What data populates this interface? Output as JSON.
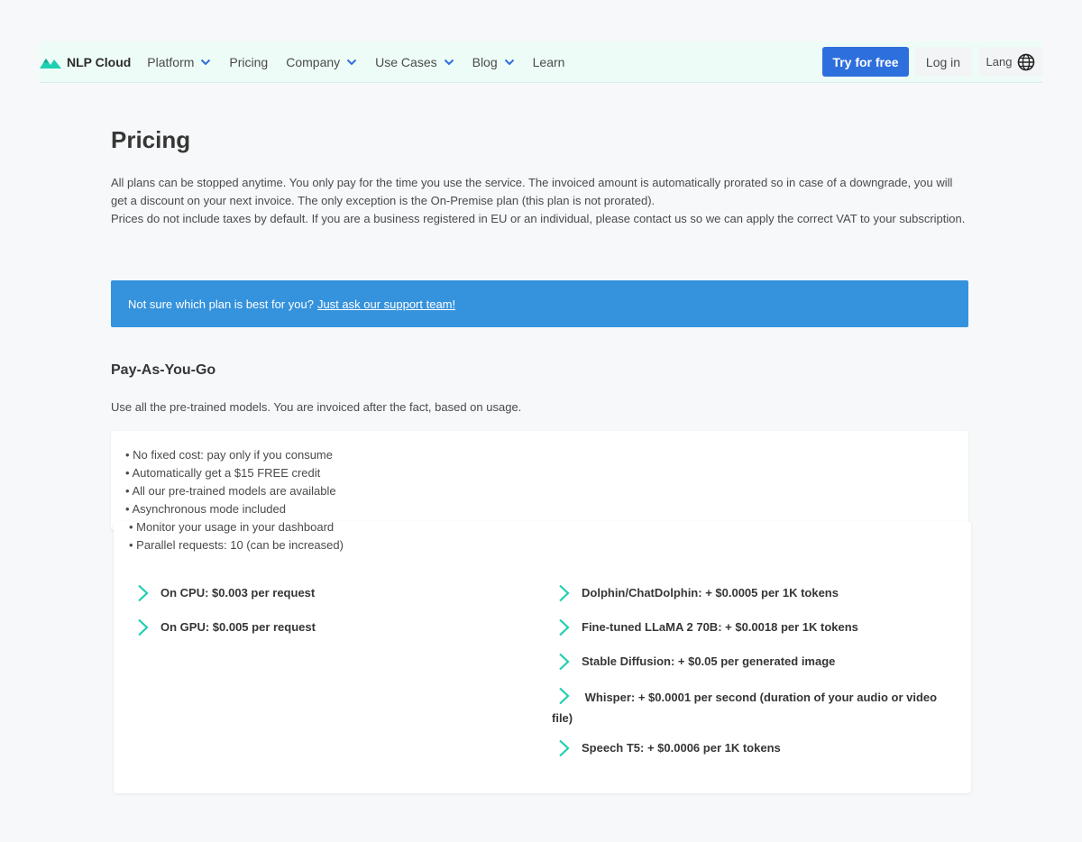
{
  "nav": {
    "brand": "NLP Cloud",
    "items": [
      {
        "label": "Platform",
        "dropdown": true
      },
      {
        "label": "Pricing",
        "dropdown": false
      },
      {
        "label": "Company",
        "dropdown": true
      },
      {
        "label": "Use Cases",
        "dropdown": true
      },
      {
        "label": "Blog",
        "dropdown": true
      },
      {
        "label": "Learn",
        "dropdown": false
      }
    ],
    "try_label": "Try for free",
    "login_label": "Log in",
    "lang_label": "Lang"
  },
  "colors": {
    "accent": "#2d6fdc",
    "teal": "#1fcfb1",
    "banner": "#3592dc"
  },
  "page": {
    "title": "Pricing",
    "intro_1": "All plans can be stopped anytime. You only pay for the time you use the service. The invoiced amount is automatically prorated so in case of a downgrade, you will get a discount on your next invoice. The only exception is the On-Premise plan (this plan is not prorated).",
    "intro_2": "Prices do not include taxes by default. If you are a business registered in EU or an individual, please contact us so we can apply the correct VAT to your subscription."
  },
  "banner": {
    "text": "Not sure which plan is best for you?",
    "link": "Just ask our support team!"
  },
  "plan": {
    "title": "Pay-As-You-Go",
    "description": "Use all the pre-trained models. You are invoiced after the fact, based on usage.",
    "features": [
      "• No fixed cost: pay only if you consume",
      "• Automatically get a $15 FREE credit",
      "• All our pre-trained models are available",
      "• Asynchronous mode included",
      "• Monitor your usage in your dashboard",
      "• Parallel requests: 10 (can be increased)"
    ],
    "prices_left": [
      "On CPU: $0.003 per request",
      "On GPU: $0.005 per request"
    ],
    "prices_right": [
      "Dolphin/ChatDolphin: + $0.0005 per 1K tokens",
      "Fine-tuned LLaMA 2 70B: + $0.0018 per 1K tokens",
      "Stable Diffusion: + $0.05 per generated image",
      "Whisper: + $0.0001 per second (duration of your audio or video file)",
      "Speech T5: + $0.0006 per 1K tokens"
    ]
  }
}
